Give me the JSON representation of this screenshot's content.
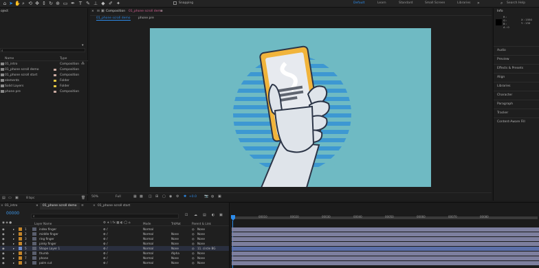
{
  "toolbar": {
    "snapping_label": "Snapping",
    "workspaces": [
      "Default",
      "Learn",
      "Standard",
      "Small Screen",
      "Libraries"
    ],
    "search_placeholder": "Search Help",
    "accent_color": "#2d8ceb"
  },
  "project": {
    "title": "oject",
    "columns": {
      "name": "Name",
      "type": "Type"
    },
    "items": [
      {
        "name": "01_intro",
        "type": "Composition",
        "icon": "composition-icon"
      },
      {
        "name": "01_phone scroll demo",
        "type": "Composition",
        "icon": "composition-icon"
      },
      {
        "name": "01_phone scroll start",
        "type": "Composition",
        "icon": "composition-icon"
      },
      {
        "name": "elements",
        "type": "Folder",
        "icon": "folder-icon"
      },
      {
        "name": "Solid Layers",
        "type": "Folder",
        "icon": "folder-icon"
      },
      {
        "name": "phone pre",
        "type": "Composition",
        "icon": "composition-icon"
      }
    ],
    "footer_bpc": "8 bpc"
  },
  "viewer": {
    "panel_title": "Composition",
    "comp_name": "01_phone scroll demo",
    "tabs": [
      "01_phone scroll demo",
      "phone pre"
    ],
    "zoom": "50%",
    "resolution": "Full",
    "exposure": "+0.0",
    "canvas_bg": "#6fbac3"
  },
  "right_panel": {
    "info_title": "Info",
    "info_values": [
      "R :",
      "G :",
      "B :",
      "A : 0"
    ],
    "info_xy": [
      "X : 1550",
      "Y : 130"
    ],
    "sections": [
      "Audio",
      "Preview",
      "Effects & Presets",
      "Align",
      "Libraries",
      "Character",
      "Paragraph",
      "Tracker",
      "Content-Aware Fill"
    ]
  },
  "timeline": {
    "tabs": [
      "01_intro",
      "01_phone scroll demo",
      "01_phone scroll start"
    ],
    "timecode": "00000",
    "columns": {
      "layer_name": "Layer Name",
      "mode": "Mode",
      "trkmat": "TrkMat",
      "parent": "Parent & Link"
    },
    "ruler_marks": [
      "00000",
      "00010",
      "00020",
      "00030",
      "00040",
      "00050",
      "00060",
      "00070",
      "00080"
    ],
    "layers": [
      {
        "num": "1",
        "name": "index finger",
        "mode": "Normal",
        "trkmat": "",
        "parent": "None",
        "color": "#c4852a",
        "bar": "#7d7f9e"
      },
      {
        "num": "2",
        "name": "middle finger",
        "mode": "Normal",
        "trkmat": "None",
        "parent": "None",
        "color": "#c4852a",
        "bar": "#7d7f9e"
      },
      {
        "num": "3",
        "name": "ring finger",
        "mode": "Normal",
        "trkmat": "None",
        "parent": "None",
        "color": "#c4852a",
        "bar": "#7d7f9e"
      },
      {
        "num": "4",
        "name": "pinky finger",
        "mode": "Normal",
        "trkmat": "None",
        "parent": "None",
        "color": "#c4852a",
        "bar": "#7d7f9e"
      },
      {
        "num": "5",
        "name": "Shape Layer 1",
        "mode": "Normal",
        "trkmat": "None",
        "parent": "11. circle BG",
        "color": "#6f8bc9",
        "bar": "#5b6fa8"
      },
      {
        "num": "6",
        "name": "thumb",
        "mode": "Normal",
        "trkmat": "Alpha",
        "parent": "None",
        "color": "#c4852a",
        "bar": "#7d7f9e"
      },
      {
        "num": "7",
        "name": "phone",
        "mode": "Normal",
        "trkmat": "None",
        "parent": "None",
        "color": "#c4852a",
        "bar": "#7d7f9e"
      },
      {
        "num": "8",
        "name": "palm cut",
        "mode": "Normal",
        "trkmat": "None",
        "parent": "None",
        "color": "#c4852a",
        "bar": "#7d7f9e"
      }
    ]
  }
}
